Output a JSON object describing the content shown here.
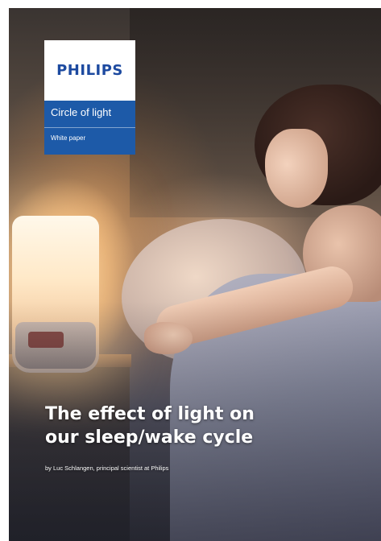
{
  "brand": {
    "logo_text": "PHILIPS",
    "title": "Circle of light",
    "subtitle": "White paper",
    "colors": {
      "logo": "#1d4aa0",
      "panel": "#1d5aa8"
    }
  },
  "cover": {
    "headline_line1": "The effect of light on",
    "headline_line2": "our sleep/wake cycle",
    "byline": "by Luc Schlangen, principal scientist at Philips"
  }
}
